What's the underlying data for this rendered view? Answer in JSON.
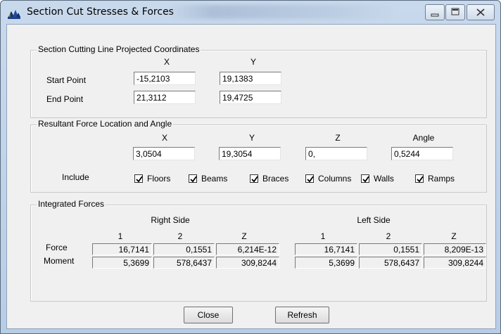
{
  "window": {
    "title": "Section Cut Stresses & Forces"
  },
  "coords": {
    "legend": "Section Cutting Line Projected Coordinates",
    "col_x": "X",
    "col_y": "Y",
    "start_label": "Start Point",
    "start_x": "-15,2103",
    "start_y": "19,1383",
    "end_label": "End Point",
    "end_x": "21,3112",
    "end_y": "19,4725"
  },
  "resultant": {
    "legend": "Resultant Force Location and Angle",
    "col_x": "X",
    "col_y": "Y",
    "col_z": "Z",
    "col_angle": "Angle",
    "x": "3,0504",
    "y": "19,3054",
    "z": "0,",
    "angle": "0,5244",
    "include_label": "Include",
    "checks": [
      {
        "label": "Floors",
        "checked": true
      },
      {
        "label": "Beams",
        "checked": true
      },
      {
        "label": "Braces",
        "checked": true
      },
      {
        "label": "Columns",
        "checked": true
      },
      {
        "label": "Walls",
        "checked": true
      },
      {
        "label": "Ramps",
        "checked": true
      }
    ]
  },
  "integrated": {
    "legend": "Integrated Forces",
    "right_title": "Right Side",
    "left_title": "Left Side",
    "cols": [
      "1",
      "2",
      "Z"
    ],
    "row_force": "Force",
    "row_moment": "Moment",
    "right": {
      "force": [
        "16,7141",
        "0,1551",
        "6,214E-12"
      ],
      "moment": [
        "5,3699",
        "578,6437",
        "309,8244"
      ]
    },
    "left": {
      "force": [
        "16,7141",
        "0,1551",
        "8,209E-13"
      ],
      "moment": [
        "5,3699",
        "578,6437",
        "309,8244"
      ]
    }
  },
  "buttons": {
    "close": "Close",
    "refresh": "Refresh"
  },
  "icons": {
    "app": "structure-app-icon",
    "minimize": "minimize-icon",
    "maximize": "maximize-icon",
    "close": "close-icon",
    "check": "checkmark-icon"
  }
}
